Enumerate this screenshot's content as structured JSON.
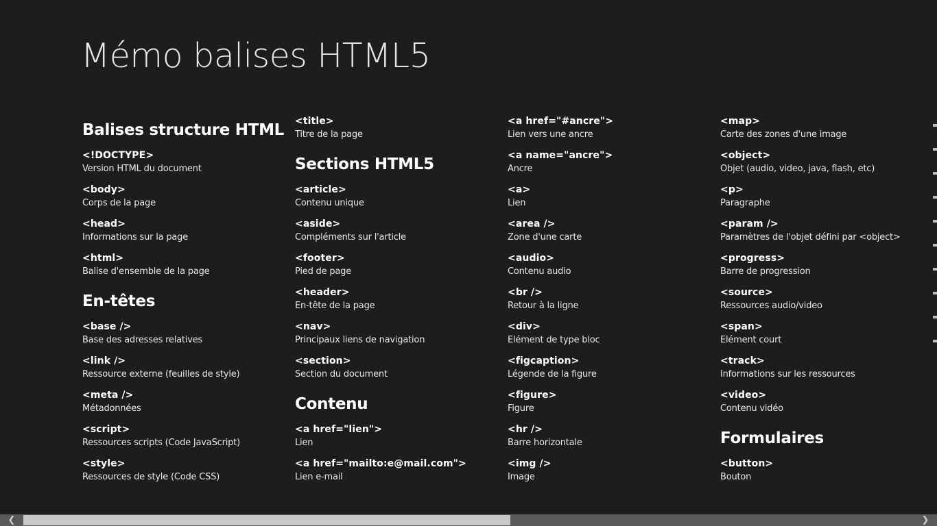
{
  "app": {
    "title": "Mémo balises HTML5"
  },
  "columns": [
    {
      "items": [
        {
          "type": "header",
          "text": "Balises structure HTML"
        },
        {
          "type": "entry",
          "tag": "<!DOCTYPE>",
          "desc": "Version HTML du document"
        },
        {
          "type": "entry",
          "tag": "<body>",
          "desc": "Corps de la page"
        },
        {
          "type": "entry",
          "tag": "<head>",
          "desc": "Informations sur la page"
        },
        {
          "type": "entry",
          "tag": "<html>",
          "desc": "Balise d'ensemble de la page"
        },
        {
          "type": "header",
          "text": "En-têtes"
        },
        {
          "type": "entry",
          "tag": "<base />",
          "desc": "Base des adresses relatives"
        },
        {
          "type": "entry",
          "tag": "<link />",
          "desc": "Ressource externe (feuilles de style)"
        },
        {
          "type": "entry",
          "tag": "<meta />",
          "desc": "Métadonnées"
        },
        {
          "type": "entry",
          "tag": "<script>",
          "desc": "Ressources scripts (Code JavaScript)"
        },
        {
          "type": "entry",
          "tag": "<style>",
          "desc": "Ressources de style (Code CSS)"
        }
      ]
    },
    {
      "items": [
        {
          "type": "entry",
          "tag": "<title>",
          "desc": "Titre de la page"
        },
        {
          "type": "header",
          "text": "Sections HTML5"
        },
        {
          "type": "entry",
          "tag": "<article>",
          "desc": "Contenu unique"
        },
        {
          "type": "entry",
          "tag": "<aside>",
          "desc": "Compléments sur l'article"
        },
        {
          "type": "entry",
          "tag": "<footer>",
          "desc": "Pied de page"
        },
        {
          "type": "entry",
          "tag": "<header>",
          "desc": "En-tête de la page"
        },
        {
          "type": "entry",
          "tag": "<nav>",
          "desc": "Principaux liens de navigation"
        },
        {
          "type": "entry",
          "tag": "<section>",
          "desc": "Section du document"
        },
        {
          "type": "header",
          "text": "Contenu"
        },
        {
          "type": "entry",
          "tag": "<a href=\"lien\">",
          "desc": "Lien"
        },
        {
          "type": "entry",
          "tag": "<a href=\"mailto:e@mail.com\">",
          "desc": "Lien e-mail"
        }
      ]
    },
    {
      "items": [
        {
          "type": "entry",
          "tag": "<a href=\"#ancre\">",
          "desc": "Lien vers une ancre"
        },
        {
          "type": "entry",
          "tag": "<a name=\"ancre\">",
          "desc": "Ancre"
        },
        {
          "type": "entry",
          "tag": "<a>",
          "desc": "Lien"
        },
        {
          "type": "entry",
          "tag": "<area />",
          "desc": "Zone d'une carte"
        },
        {
          "type": "entry",
          "tag": "<audio>",
          "desc": "Contenu audio"
        },
        {
          "type": "entry",
          "tag": "<br />",
          "desc": "Retour à la ligne"
        },
        {
          "type": "entry",
          "tag": "<div>",
          "desc": "Elément de type bloc"
        },
        {
          "type": "entry",
          "tag": "<figcaption>",
          "desc": "Légende de la figure"
        },
        {
          "type": "entry",
          "tag": "<figure>",
          "desc": "Figure"
        },
        {
          "type": "entry",
          "tag": "<hr />",
          "desc": "Barre horizontale"
        },
        {
          "type": "entry",
          "tag": "<img />",
          "desc": "Image"
        }
      ]
    },
    {
      "items": [
        {
          "type": "entry",
          "tag": "<map>",
          "desc": "Carte des zones d'une image"
        },
        {
          "type": "entry",
          "tag": "<object>",
          "desc": "Objet (audio, video, java, flash, etc)"
        },
        {
          "type": "entry",
          "tag": "<p>",
          "desc": "Paragraphe"
        },
        {
          "type": "entry",
          "tag": "<param />",
          "desc": "Paramètres de l'objet défini par <object>"
        },
        {
          "type": "entry",
          "tag": "<progress>",
          "desc": "Barre de progression"
        },
        {
          "type": "entry",
          "tag": "<source>",
          "desc": "Ressources audio/video"
        },
        {
          "type": "entry",
          "tag": "<span>",
          "desc": "Elément court"
        },
        {
          "type": "entry",
          "tag": "<track>",
          "desc": "Informations sur les ressources"
        },
        {
          "type": "entry",
          "tag": "<video>",
          "desc": "Contenu vidéo"
        },
        {
          "type": "header",
          "text": "Formulaires"
        },
        {
          "type": "entry",
          "tag": "<button>",
          "desc": "Bouton"
        }
      ]
    }
  ],
  "scrollbar": {
    "left_arrow": "❮",
    "right_arrow": "❯",
    "scroll_position": 0.52
  }
}
